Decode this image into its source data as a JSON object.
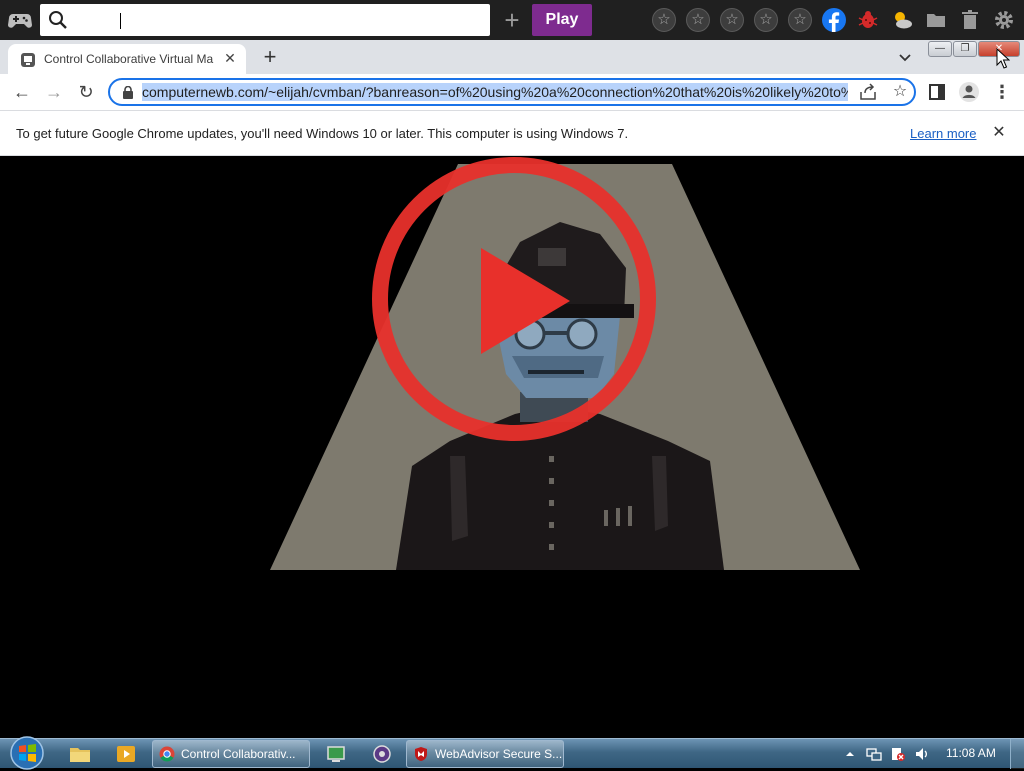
{
  "gamebar": {
    "play_label": "Play",
    "new_label": "+",
    "favorites": [
      "☆",
      "☆",
      "☆",
      "☆",
      "☆"
    ]
  },
  "tab": {
    "title": "Control Collaborative Virtual Ma",
    "close": "✕"
  },
  "new_tab": "+",
  "window_controls": {
    "min": "—",
    "max": "❐",
    "close": "✕"
  },
  "toolbar": {
    "back": "←",
    "forward": "→",
    "reload": "↻",
    "url": "computernewb.com/~elijah/cvmban/?banreason=of%20using%20a%20connection%20that%20is%20likely%20to%",
    "bookmark": "☆",
    "menu": "⋮"
  },
  "infobar": {
    "message": "To get future Google Chrome updates, you'll need Windows 10 or later. This computer is using Windows 7.",
    "learn_more": "Learn more",
    "close": "✕"
  },
  "taskbar": {
    "tasks": [
      {
        "label": "Control Collaborativ..."
      },
      {
        "label": "WebAdvisor Secure S..."
      }
    ],
    "clock": "11:08 AM"
  },
  "colors": {
    "play_button": "#7e2b8f",
    "omnibox_border": "#1a73e8",
    "url_selection": "#b8d3fb",
    "play_overlay": "#e8302b",
    "spotlight": "#7e7a6e"
  }
}
